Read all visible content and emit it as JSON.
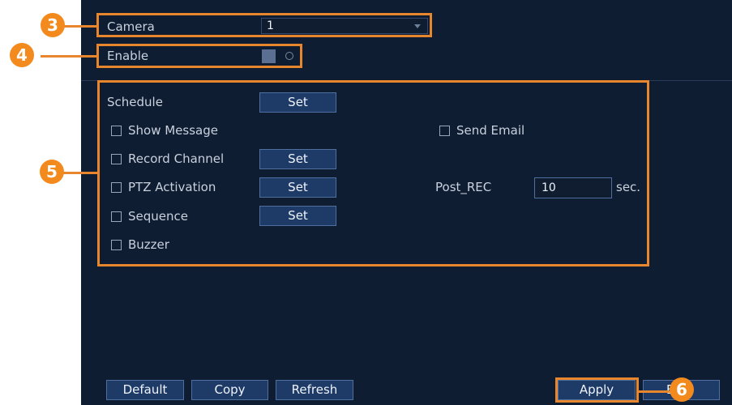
{
  "camera": {
    "label": "Camera",
    "value": "1"
  },
  "enable": {
    "label": "Enable"
  },
  "actions": {
    "schedule_label": "Schedule",
    "schedule_set": "Set",
    "show_message": "Show Message",
    "send_email": "Send Email",
    "record_channel": "Record Channel",
    "record_channel_set": "Set",
    "ptz_activation": "PTZ Activation",
    "ptz_set": "Set",
    "post_rec_label": "Post_REC",
    "post_rec_value": "10",
    "post_rec_unit": "sec.",
    "sequence": "Sequence",
    "sequence_set": "Set",
    "buzzer": "Buzzer"
  },
  "footer": {
    "default": "Default",
    "copy": "Copy",
    "refresh": "Refresh",
    "apply": "Apply",
    "back_partial": "B"
  },
  "callouts": {
    "c3": "3",
    "c4": "4",
    "c5": "5",
    "c6": "6"
  },
  "colors": {
    "panel": "#0f1d33",
    "highlight": "#e8862d",
    "callout": "#f28a1e",
    "button": "#1e3a66"
  }
}
